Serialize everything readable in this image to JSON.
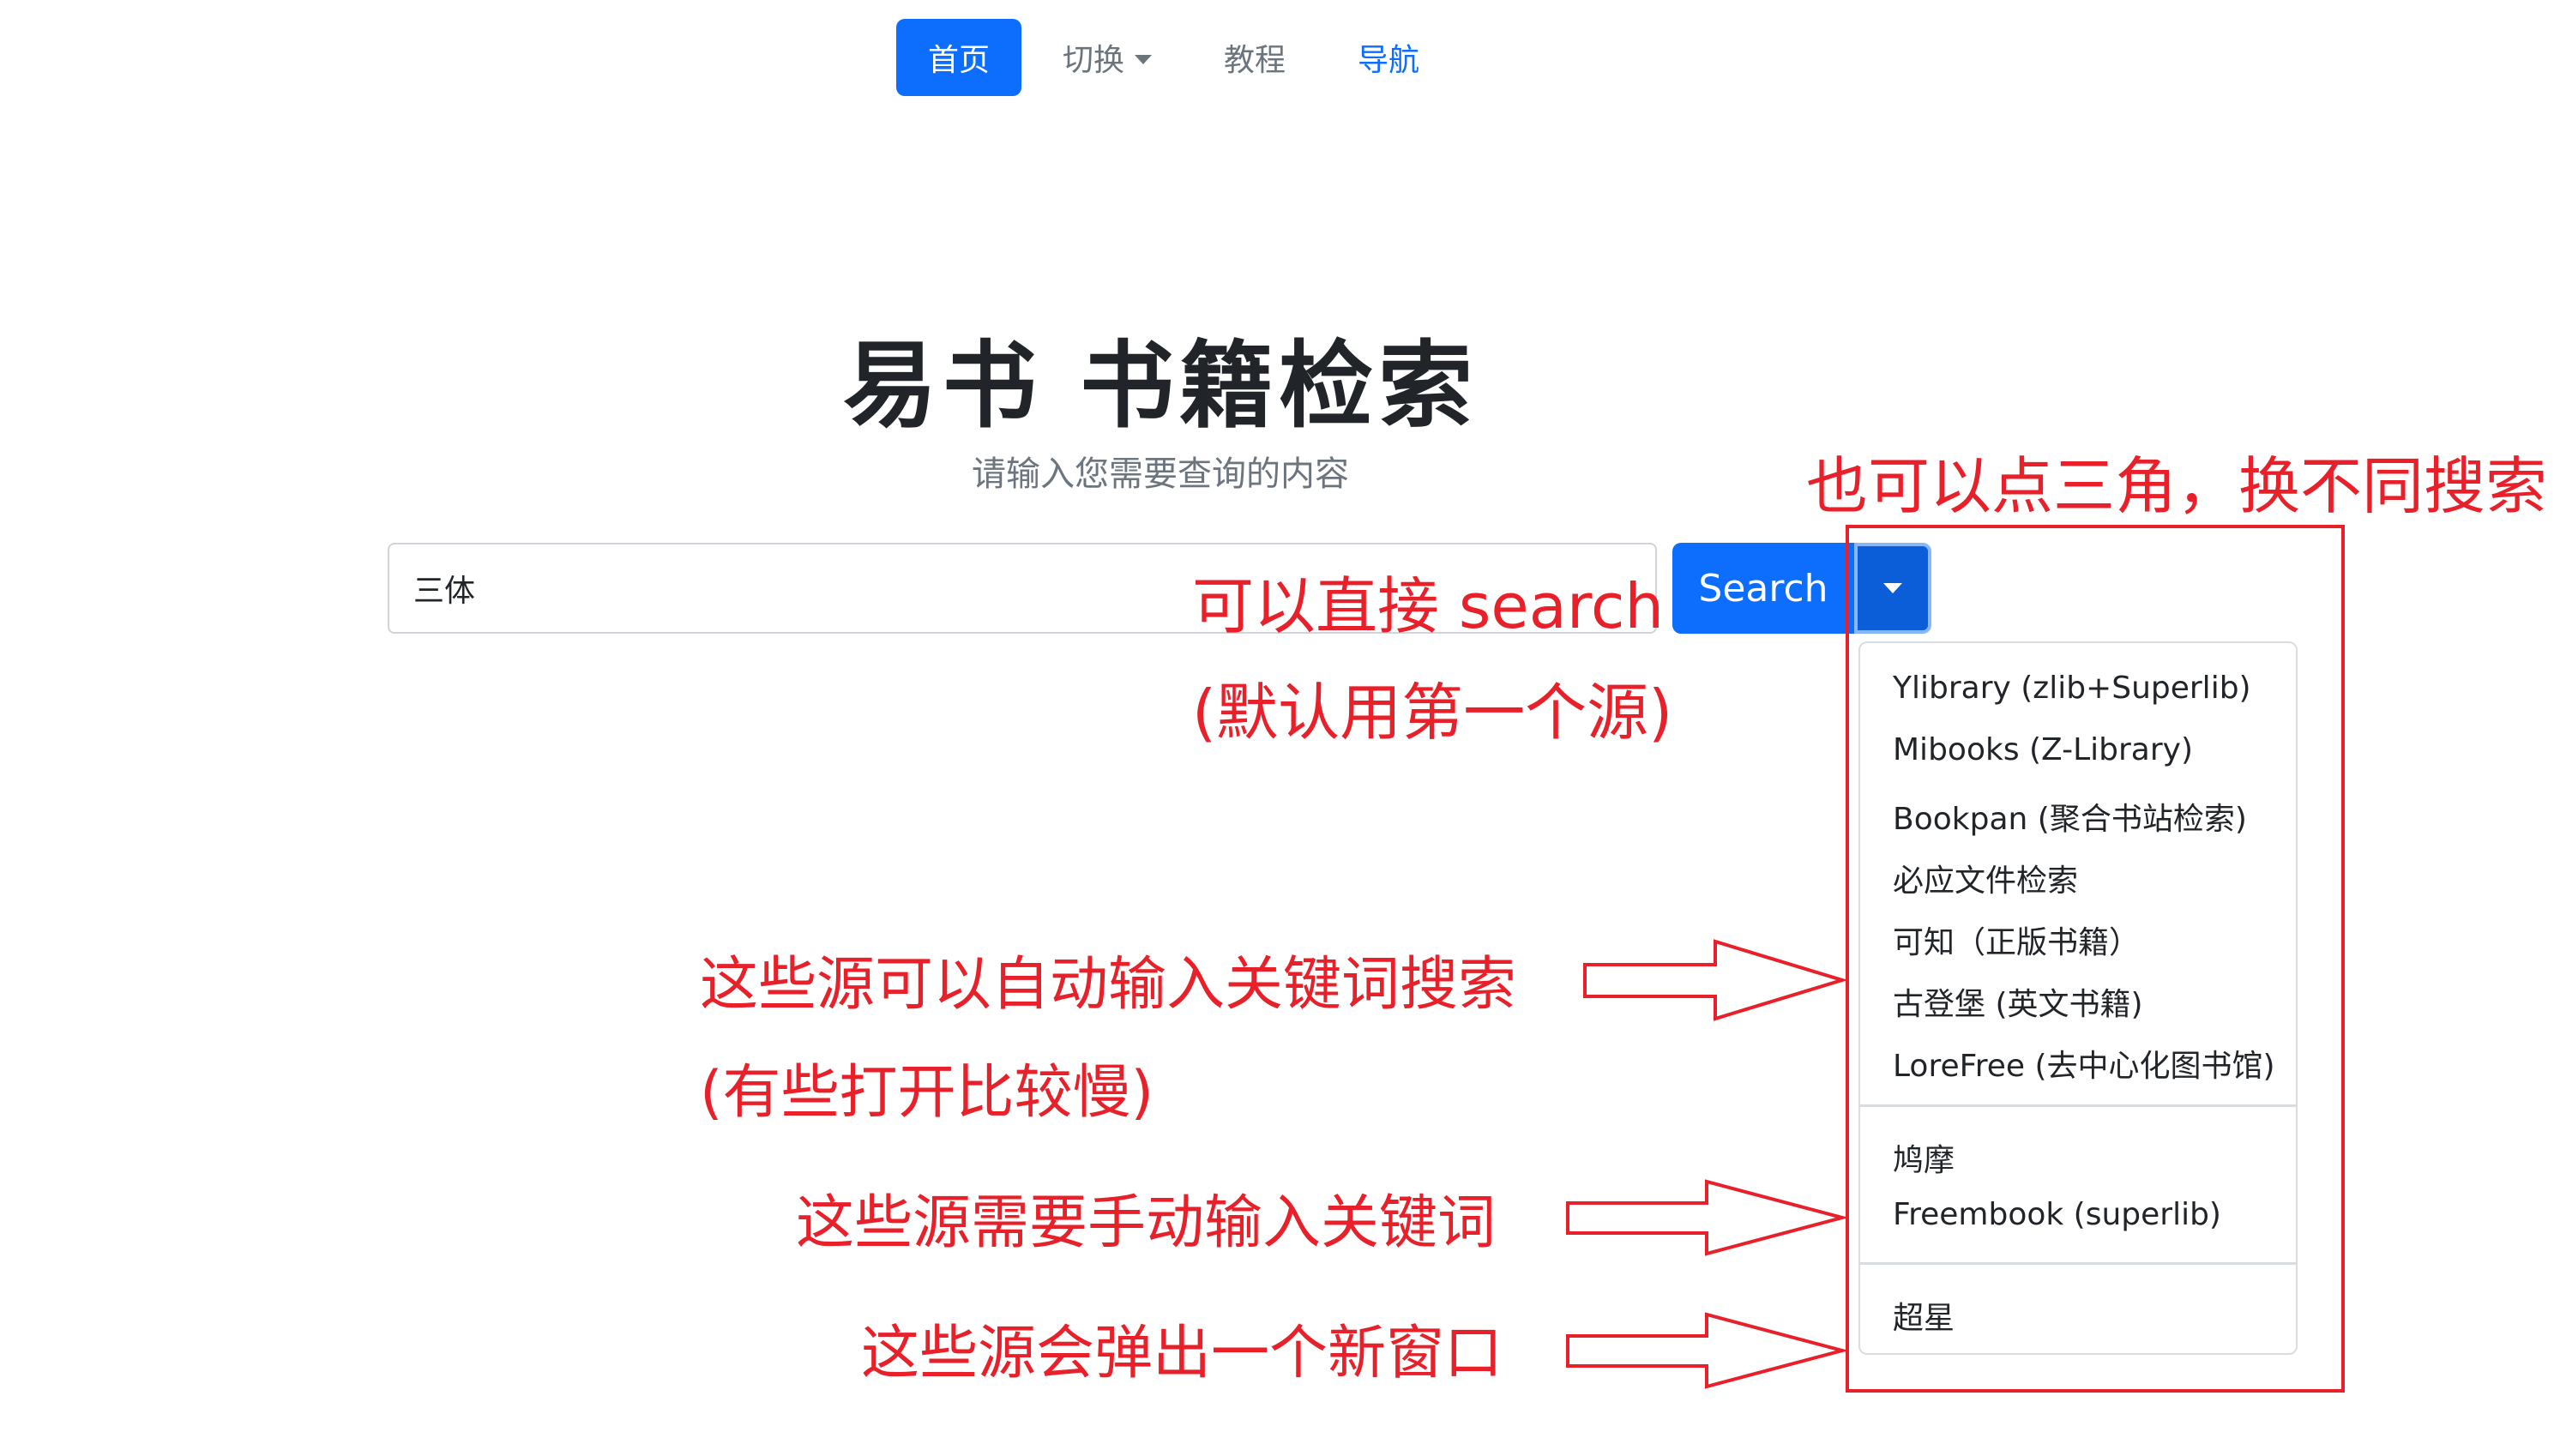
{
  "nav": {
    "items": [
      {
        "label": "首页"
      },
      {
        "label": "切换"
      },
      {
        "label": "教程"
      },
      {
        "label": "导航"
      }
    ]
  },
  "hero": {
    "title": "易书 书籍检索",
    "subtitle": "请输入您需要查询的内容"
  },
  "search": {
    "value": "三体",
    "button_label": "Search"
  },
  "dropdown": {
    "group1": [
      {
        "label": "Ylibrary (zlib+Superlib)"
      },
      {
        "label": "Mibooks (Z-Library)"
      },
      {
        "label": "Bookpan (聚合书站检索)"
      },
      {
        "label": "必应文件检索"
      },
      {
        "label": "可知（正版书籍）"
      },
      {
        "label": "古登堡 (英文书籍)"
      },
      {
        "label": "LoreFree (去中心化图书馆)"
      }
    ],
    "group2": [
      {
        "label": "鸠摩"
      },
      {
        "label": "Freembook (superlib)"
      }
    ],
    "group3": [
      {
        "label": "超星"
      }
    ]
  },
  "annotations": {
    "triangle_hint": "也可以点三角，换不同搜索",
    "search_hint_1": "可以直接 search",
    "search_hint_2": "(默认用第一个源)",
    "auto_hint_1": "这些源可以自动输入关键词搜索",
    "auto_hint_2": "(有些打开比较慢)",
    "manual_hint": "这些源需要手动输入关键词",
    "popup_hint": "这些源会弹出一个新窗口",
    "color": "#e8202a"
  },
  "colors": {
    "primary": "#0d6efd",
    "primary_dark": "#0b5ed7",
    "muted": "#6c757d",
    "text": "#212529"
  }
}
